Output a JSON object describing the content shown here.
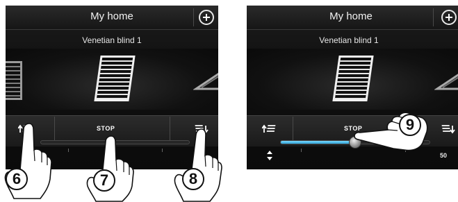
{
  "left_screen": {
    "header": {
      "title": "My home",
      "add_icon": "plus-circle-icon"
    },
    "device": {
      "name": "Venetian blind 1"
    },
    "controls": {
      "raise_icon": "blind-up-icon",
      "stop_label": "STOP",
      "lower_icon": "blind-down-icon"
    }
  },
  "right_screen": {
    "header": {
      "title": "My home",
      "add_icon": "plus-circle-icon"
    },
    "device": {
      "name": "Venetian blind 1"
    },
    "controls": {
      "raise_icon": "blind-up-icon",
      "stop_label": "STOP",
      "lower_icon": "blind-down-icon",
      "adjust_icon": "up-down-arrows-icon",
      "slider": {
        "position_percent": 50,
        "value_label": "50",
        "fill_color": "#2b9fd6"
      }
    }
  },
  "callouts": [
    "6",
    "7",
    "8",
    "9"
  ]
}
